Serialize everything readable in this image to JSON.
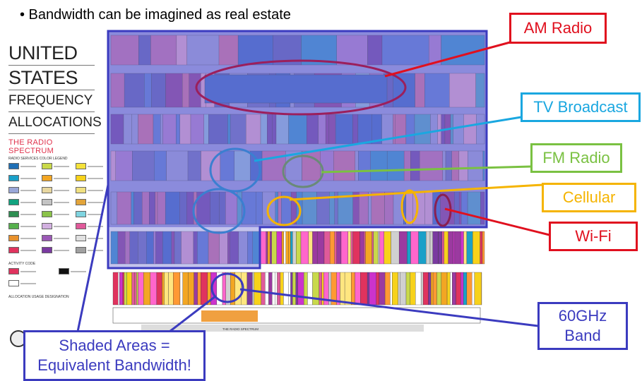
{
  "header": {
    "bullet_text": "• Bandwidth can be imagined as real estate"
  },
  "poster": {
    "title_lines": [
      "UNITED",
      "STATES",
      "FREQUENCY",
      "ALLOCATIONS"
    ],
    "subtitle": "THE RADIO SPECTRUM",
    "legend_heading": "RADIO SERVICES COLOR LEGEND",
    "activity_heading": "ACTIVITY CODE",
    "usage_heading": "ALLOCATION USAGE DESIGNATION",
    "bottom_label": "THE RADIO SPECTRUM"
  },
  "callouts": {
    "am_radio": "AM Radio",
    "tv_broadcast": "TV Broadcast",
    "fm_radio": "FM Radio",
    "cellular": "Cellular",
    "wifi": "Wi-Fi",
    "band_60ghz_line1": "60GHz",
    "band_60ghz_line2": "Band",
    "shaded_line1": "Shaded Areas =",
    "shaded_line2": "Equivalent Bandwidth!"
  },
  "colors": {
    "am": "#e0101e",
    "tv": "#1aa7e0",
    "fm": "#7ac142",
    "cellular": "#f5b400",
    "wifi": "#e0101e",
    "navy": "#3b3bbf",
    "shade": "#7b7bd6",
    "am_ellipse": "#9b1f5c",
    "tv_ellipse": "#3b7fd0",
    "fm_ellipse": "#6a8a78",
    "wifi_ellipse": "#8a2052"
  }
}
